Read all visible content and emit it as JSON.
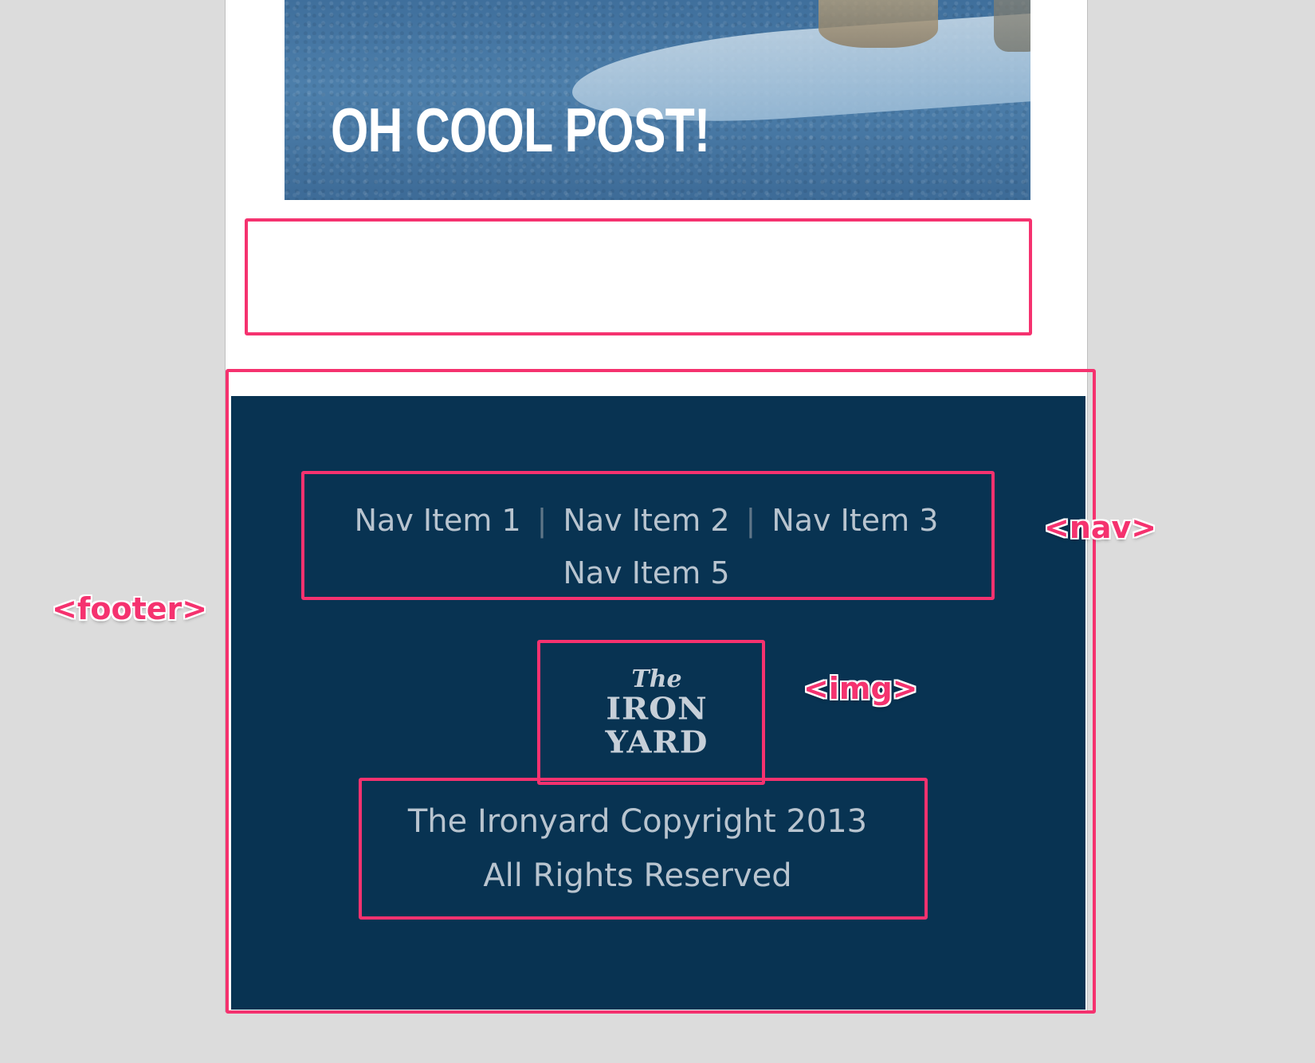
{
  "hero": {
    "title": "OH COOL POST!"
  },
  "footer": {
    "nav": {
      "items": [
        "Nav Item 1",
        "Nav Item 2",
        "Nav Item 3",
        "Nav Item 5"
      ],
      "separator": "|"
    },
    "logo": {
      "line1": "The",
      "line2": "IRON",
      "line3": "YARD"
    },
    "copyright": {
      "line1": "The Ironyard Copyright 2013",
      "line2": "All Rights Reserved"
    }
  },
  "annotations": {
    "footer_label": "<footer>",
    "nav_label": "<nav>",
    "img_label": "<img>"
  },
  "colors": {
    "accent": "#f5326f",
    "footer_bg": "#083352",
    "footer_text": "#b8c4cf",
    "hero_tint": "#4d7fab",
    "backdrop": "#dcdcdc"
  }
}
